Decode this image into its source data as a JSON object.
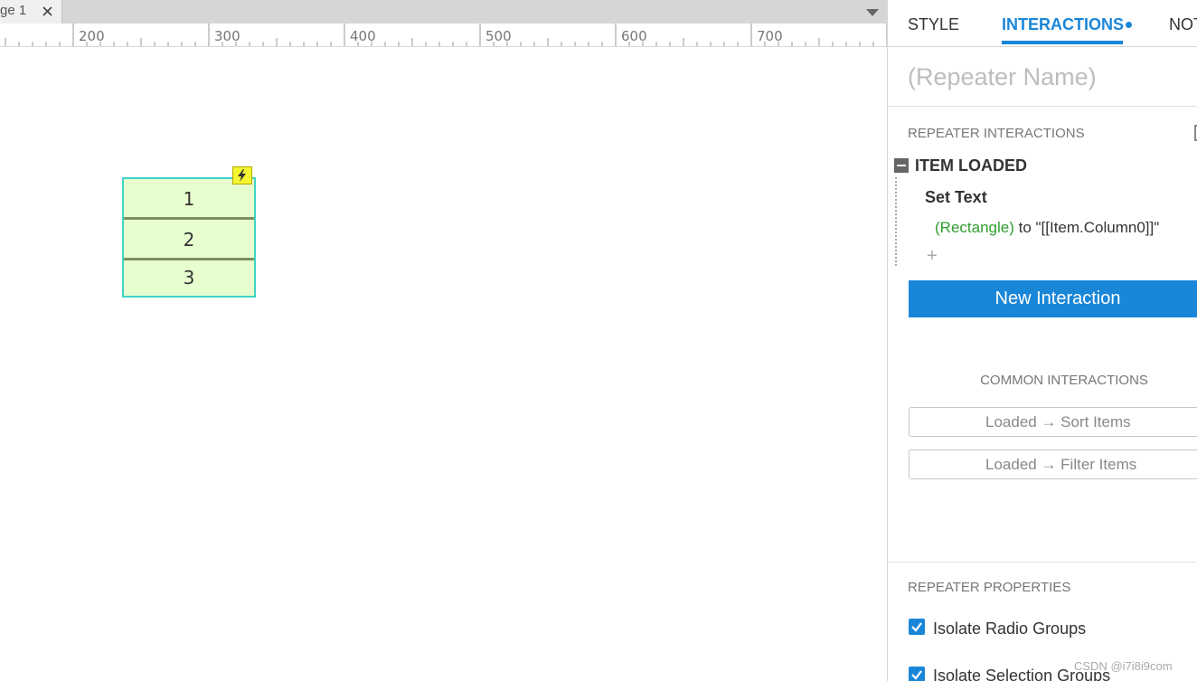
{
  "tabs": {
    "page_tab_label": "ge 1"
  },
  "ruler": {
    "labels": [
      "200",
      "300",
      "400",
      "500",
      "600",
      "700"
    ]
  },
  "repeater": {
    "rows": [
      "1",
      "2",
      "3"
    ],
    "fill_color": "#e7ffce",
    "border_color": "#3fd2c8",
    "badge_icon": "lightning-bolt-icon"
  },
  "panel": {
    "tabs": {
      "style": "STYLE",
      "interactions": "INTERACTIONS",
      "notes": "NOT"
    },
    "name_placeholder": "(Repeater Name)",
    "repeater_interactions_title": "REPEATER INTERACTIONS",
    "event": {
      "title": "ITEM LOADED",
      "action_title": "Set Text",
      "action_target": "(Rectangle)",
      "action_rest": " to \"[[Item.Column0]]\"",
      "add_symbol": "+"
    },
    "new_interaction_label": "New Interaction",
    "common_title": "COMMON INTERACTIONS",
    "common_buttons": [
      "Loaded → Sort Items",
      "Loaded → Filter Items"
    ],
    "properties_title": "REPEATER PROPERTIES",
    "checkboxes": [
      {
        "label": "Isolate Radio Groups",
        "checked": true
      },
      {
        "label": "Isolate Selection Groups",
        "checked": true
      }
    ],
    "accent_color": "#1a86d8"
  },
  "watermark": "CSDN @i7i8i9com"
}
